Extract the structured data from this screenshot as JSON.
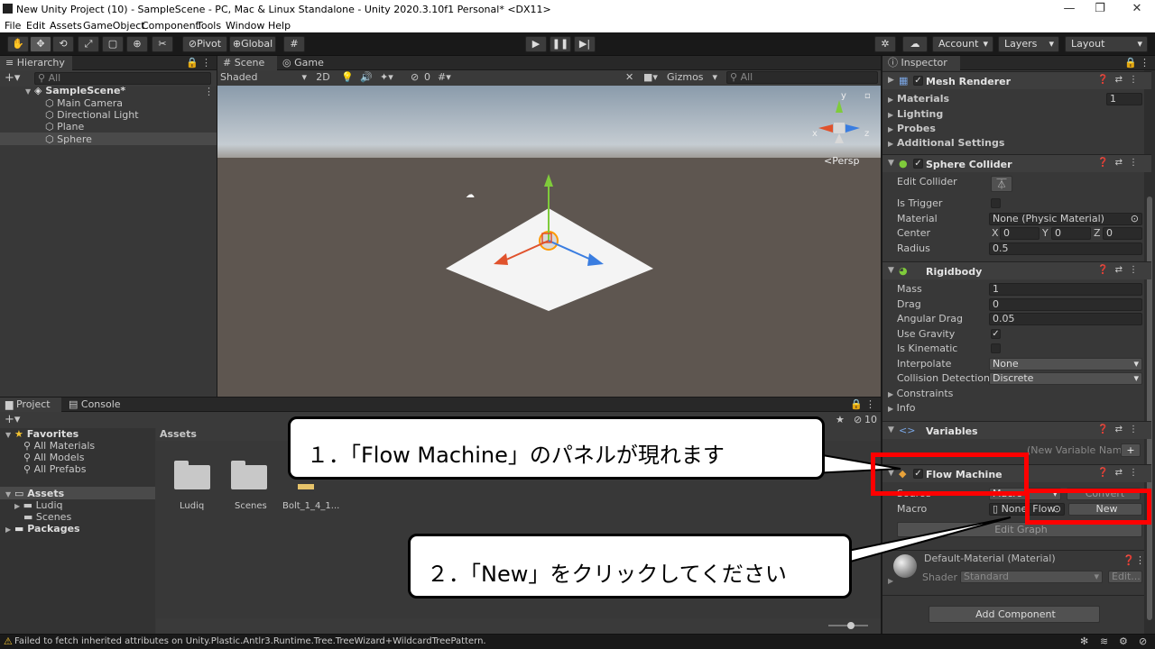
{
  "window": {
    "title": "New Unity Project (10) - SampleScene - PC, Mac & Linux Standalone - Unity 2020.3.10f1 Personal* <DX11>",
    "minimize": "—",
    "maximize": "❐",
    "close": "✕"
  },
  "menu": [
    "File",
    "Edit",
    "Assets",
    "GameObject",
    "Component",
    "Tools",
    "Window",
    "Help"
  ],
  "toolbar": {
    "pivot": "Pivot",
    "global": "Global",
    "account": "Account",
    "layers": "Layers",
    "layout": "Layout"
  },
  "hierarchy": {
    "tab": "Hierarchy",
    "search_placeholder": "All",
    "scene": "SampleScene*",
    "items": [
      "Main Camera",
      "Directional Light",
      "Plane",
      "Sphere"
    ]
  },
  "scene_view": {
    "tabs": [
      "Scene",
      "Game"
    ],
    "shading": "Shaded",
    "mode_2d": "2D",
    "hidden_count": "0",
    "gizmos": "Gizmos",
    "search_placeholder": "All",
    "persp": "Persp",
    "axis_x": "x",
    "axis_z": "z",
    "axis_y": "y"
  },
  "project": {
    "tabs": [
      "Project",
      "Console"
    ],
    "favorites": "Favorites",
    "favorite_items": [
      "All Materials",
      "All Models",
      "All Prefabs"
    ],
    "assets": "Assets",
    "asset_children": [
      "Ludiq",
      "Scenes"
    ],
    "packages": "Packages",
    "breadcrumb": "Assets",
    "hidden_count": "10",
    "files": [
      "Ludiq",
      "Scenes",
      "Bolt_1_4_1..."
    ]
  },
  "status": {
    "message": "Failed to fetch inherited attributes on Unity.Plastic.Antlr3.Runtime.Tree.TreeWizard+WildcardTreePattern."
  },
  "inspector": {
    "tab": "Inspector",
    "mesh_renderer": {
      "title": "Mesh Renderer",
      "materials_label": "Materials",
      "materials_value": "1",
      "lighting": "Lighting",
      "probes": "Probes",
      "additional": "Additional Settings"
    },
    "sphere_collider": {
      "title": "Sphere Collider",
      "edit_collider": "Edit Collider",
      "is_trigger": "Is Trigger",
      "material": "Material",
      "material_value": "None (Physic Material)",
      "center": "Center",
      "x_label": "X",
      "x_value": "0",
      "y_label": "Y",
      "y_value": "0",
      "z_label": "Z",
      "z_value": "0",
      "radius": "Radius",
      "radius_value": "0.5"
    },
    "rigidbody": {
      "title": "Rigidbody",
      "mass": "Mass",
      "mass_value": "1",
      "drag": "Drag",
      "drag_value": "0",
      "angular_drag": "Angular Drag",
      "angular_drag_value": "0.05",
      "use_gravity": "Use Gravity",
      "is_kinematic": "Is Kinematic",
      "interpolate": "Interpolate",
      "interpolate_value": "None",
      "collision": "Collision Detection",
      "collision_value": "Discrete",
      "constraints": "Constraints",
      "info": "Info"
    },
    "variables": {
      "title": "Variables",
      "new_name_placeholder": "(New Variable Name)",
      "add": "+"
    },
    "flow_machine": {
      "title": "Flow Machine",
      "source": "Source",
      "source_value": "Macro",
      "convert": "Convert",
      "macro": "Macro",
      "macro_value": "None",
      "macro_suffix": "Flow",
      "new_button": "New",
      "edit_graph": "Edit Graph"
    },
    "material": {
      "title": "Default-Material (Material)",
      "shader": "Shader",
      "shader_value": "Standard",
      "edit": "Edit..."
    },
    "add_component": "Add Component"
  },
  "callouts": {
    "step1": "１．「Flow Machine」のパネルが現れます",
    "step2": "２．「New」をクリックしてください"
  },
  "colors": {
    "highlight": "#ff0000",
    "panel": "#383838",
    "sky": "#a6b9cc",
    "ground": "#5e5650"
  }
}
